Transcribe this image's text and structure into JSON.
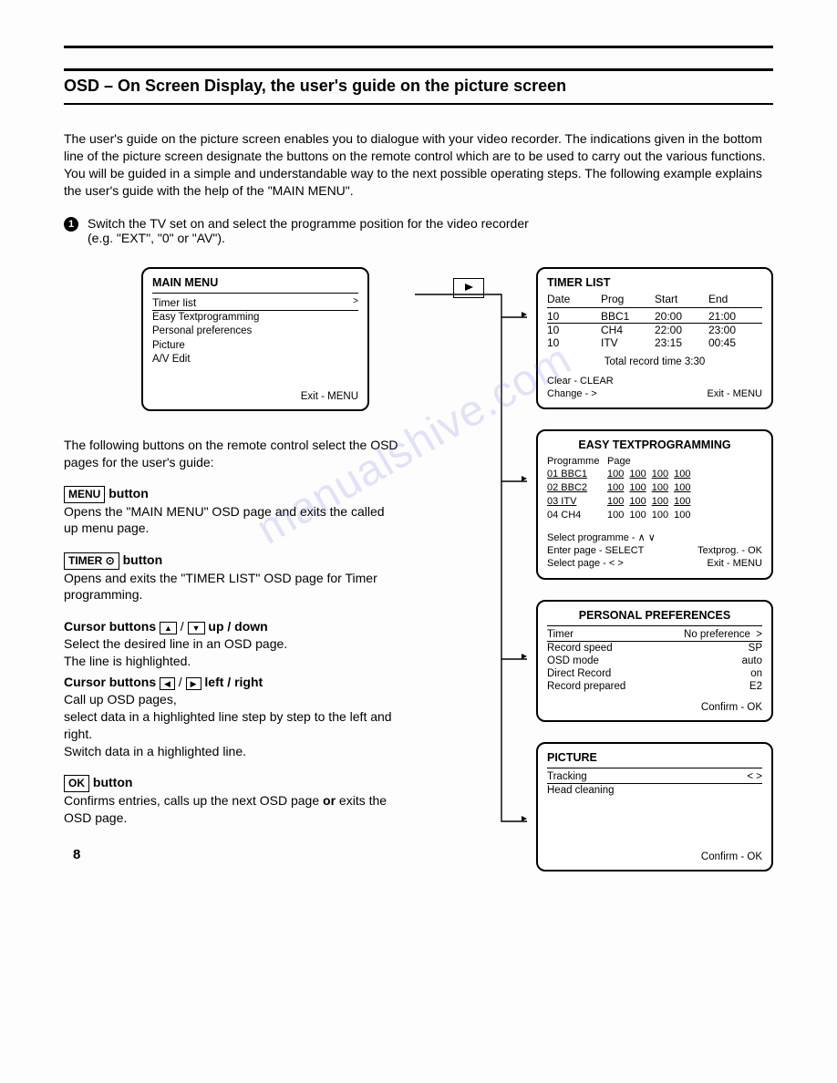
{
  "title": "OSD – On Screen Display, the user's guide on the picture screen",
  "intro": "The user's guide on the picture screen enables you to dialogue with your video recorder. The indications given in the bottom line of the picture screen designate the buttons on the remote control which are to be used to carry out the various functions. You will be guided in a simple and understandable way to the next possible operating steps. The following example explains the user's guide with the help of the \"MAIN MENU\".",
  "step1": {
    "num": "1",
    "text1": "Switch the TV set on and select the programme position for the video recorder",
    "text2": "(e.g. \"EXT\", \"0\" or \"AV\")."
  },
  "left_intro": "The following buttons on the remote control select the OSD pages for the user's guide:",
  "buttons": {
    "menu": {
      "label": "MENU",
      "after": " button",
      "desc": "Opens the \"MAIN MENU\" OSD page and exits the called up menu page."
    },
    "timer": {
      "label": "TIMER ⊙",
      "after": " button",
      "desc": "Opens and exits the \"TIMER LIST\" OSD page for Timer programming."
    },
    "cursor_ud": {
      "title1": "Cursor buttons ",
      "title2": " up / down",
      "up": "▲",
      "down": "▼",
      "desc1": "Select the desired line in an OSD page.",
      "desc2": "The line is highlighted."
    },
    "cursor_lr": {
      "title1": "Cursor buttons ",
      "title2": " left / right",
      "left": "◀",
      "right": "▶",
      "desc1": "Call up OSD pages,",
      "desc2": "select data in a highlighted line step by step to the left and right.",
      "desc3": "Switch data in a highlighted line."
    },
    "ok": {
      "label": "OK",
      "after": " button",
      "desc1": "Confirms entries, calls up the next OSD page ",
      "or": "or",
      "desc2": " exits the OSD page."
    }
  },
  "main_menu": {
    "title": "MAIN MENU",
    "selected": "Timer list",
    "items": [
      "Easy Textprogramming",
      "Personal preferences",
      "Picture",
      "A/V Edit"
    ],
    "exit": "Exit - MENU"
  },
  "timer_list": {
    "title": "TIMER LIST",
    "headers": [
      "Date",
      "Prog",
      "Start",
      "End"
    ],
    "rows": [
      [
        "10",
        "BBC1",
        "20:00",
        "21:00"
      ],
      [
        "10",
        "CH4",
        "22:00",
        "23:00"
      ],
      [
        "10",
        "ITV",
        "23:15",
        "00:45"
      ]
    ],
    "total": "Total record time  3:30",
    "clear": "Clear - CLEAR",
    "change": "Change - >",
    "exit": "Exit - MENU"
  },
  "easy_text": {
    "title": "EASY TEXTPROGRAMMING",
    "head_prog": "Programme",
    "head_page": "Page",
    "rows": [
      [
        "01 BBC1",
        "100",
        "100",
        "100",
        "100"
      ],
      [
        "02 BBC2",
        "100",
        "100",
        "100",
        "100"
      ],
      [
        "03 ITV",
        "100",
        "100",
        "100",
        "100"
      ],
      [
        "04 CH4",
        "100",
        "100",
        "100",
        "100"
      ]
    ],
    "foot1": "Select programme - ∧ ∨",
    "foot2l": "Enter page - SELECT",
    "foot2r": "Textprog. - OK",
    "foot3l": "Select page - < >",
    "foot3r": "Exit - MENU"
  },
  "prefs": {
    "title": "PERSONAL PREFERENCES",
    "rows": [
      [
        "Timer",
        "No preference",
        ">"
      ],
      [
        "Record speed",
        "SP",
        ""
      ],
      [
        "OSD mode",
        "auto",
        ""
      ],
      [
        "Direct Record",
        "on",
        ""
      ],
      [
        "Record prepared",
        "E2",
        ""
      ]
    ],
    "confirm": "Confirm - OK"
  },
  "picture": {
    "title": "PICTURE",
    "row1": "Tracking",
    "row1r": "< >",
    "row2": "Head cleaning",
    "confirm": "Confirm - OK"
  },
  "page_num": "8",
  "watermark": "manualshive.com"
}
